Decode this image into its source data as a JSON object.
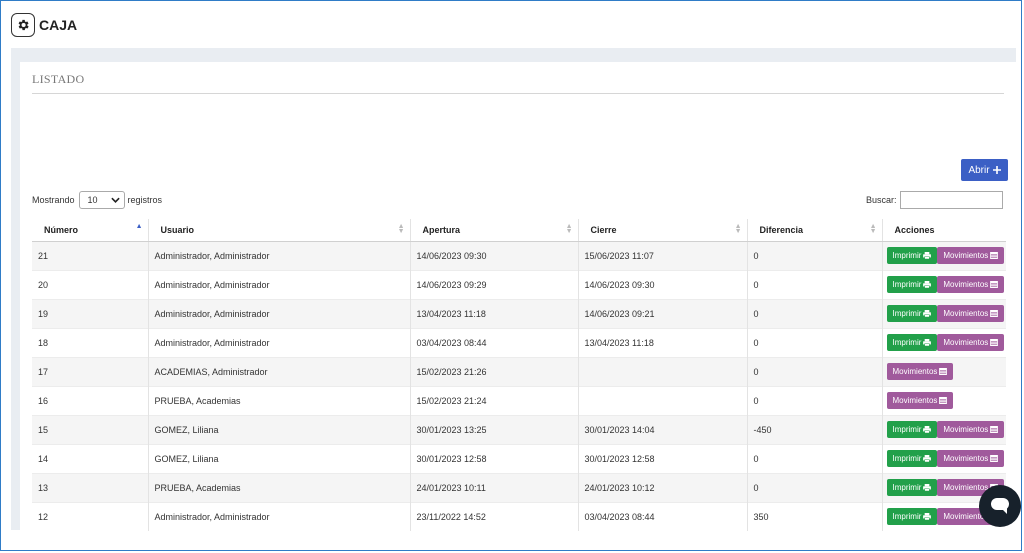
{
  "header": {
    "title": "CAJA"
  },
  "section": {
    "title": "LISTADO"
  },
  "toolbar": {
    "abrir_label": "Abrir"
  },
  "length": {
    "prefix": "Mostrando",
    "value": "10",
    "suffix": "registros"
  },
  "search": {
    "label": "Buscar:",
    "value": ""
  },
  "table": {
    "columns": [
      "Número",
      "Usuario",
      "Apertura",
      "Cierre",
      "Diferencia",
      "Acciones"
    ],
    "rows": [
      {
        "numero": "21",
        "usuario": "Administrador, Administrador",
        "apertura": "14/06/2023 09:30",
        "cierre": "15/06/2023 11:07",
        "diferencia": "0",
        "imprimir": true
      },
      {
        "numero": "20",
        "usuario": "Administrador, Administrador",
        "apertura": "14/06/2023 09:29",
        "cierre": "14/06/2023 09:30",
        "diferencia": "0",
        "imprimir": true
      },
      {
        "numero": "19",
        "usuario": "Administrador, Administrador",
        "apertura": "13/04/2023 11:18",
        "cierre": "14/06/2023 09:21",
        "diferencia": "0",
        "imprimir": true
      },
      {
        "numero": "18",
        "usuario": "Administrador, Administrador",
        "apertura": "03/04/2023 08:44",
        "cierre": "13/04/2023 11:18",
        "diferencia": "0",
        "imprimir": true
      },
      {
        "numero": "17",
        "usuario": "ACADEMIAS, Administrador",
        "apertura": "15/02/2023 21:26",
        "cierre": "",
        "diferencia": "0",
        "imprimir": false
      },
      {
        "numero": "16",
        "usuario": "PRUEBA, Academias",
        "apertura": "15/02/2023 21:24",
        "cierre": "",
        "diferencia": "0",
        "imprimir": false
      },
      {
        "numero": "15",
        "usuario": "GOMEZ, Liliana",
        "apertura": "30/01/2023 13:25",
        "cierre": "30/01/2023 14:04",
        "diferencia": "-450",
        "imprimir": true
      },
      {
        "numero": "14",
        "usuario": "GOMEZ, Liliana",
        "apertura": "30/01/2023 12:58",
        "cierre": "30/01/2023 12:58",
        "diferencia": "0",
        "imprimir": true
      },
      {
        "numero": "13",
        "usuario": "PRUEBA, Academias",
        "apertura": "24/01/2023 10:11",
        "cierre": "24/01/2023 10:12",
        "diferencia": "0",
        "imprimir": true
      },
      {
        "numero": "12",
        "usuario": "Administrador, Administrador",
        "apertura": "23/11/2022 14:52",
        "cierre": "03/04/2023 08:44",
        "diferencia": "350",
        "imprimir": true
      }
    ],
    "actions": {
      "imprimir": "Imprimir",
      "movimientos": "Movimientos"
    }
  },
  "colors": {
    "primary": "#3b5fc5",
    "success": "#22a04a",
    "movimientos": "#a05a9c"
  }
}
